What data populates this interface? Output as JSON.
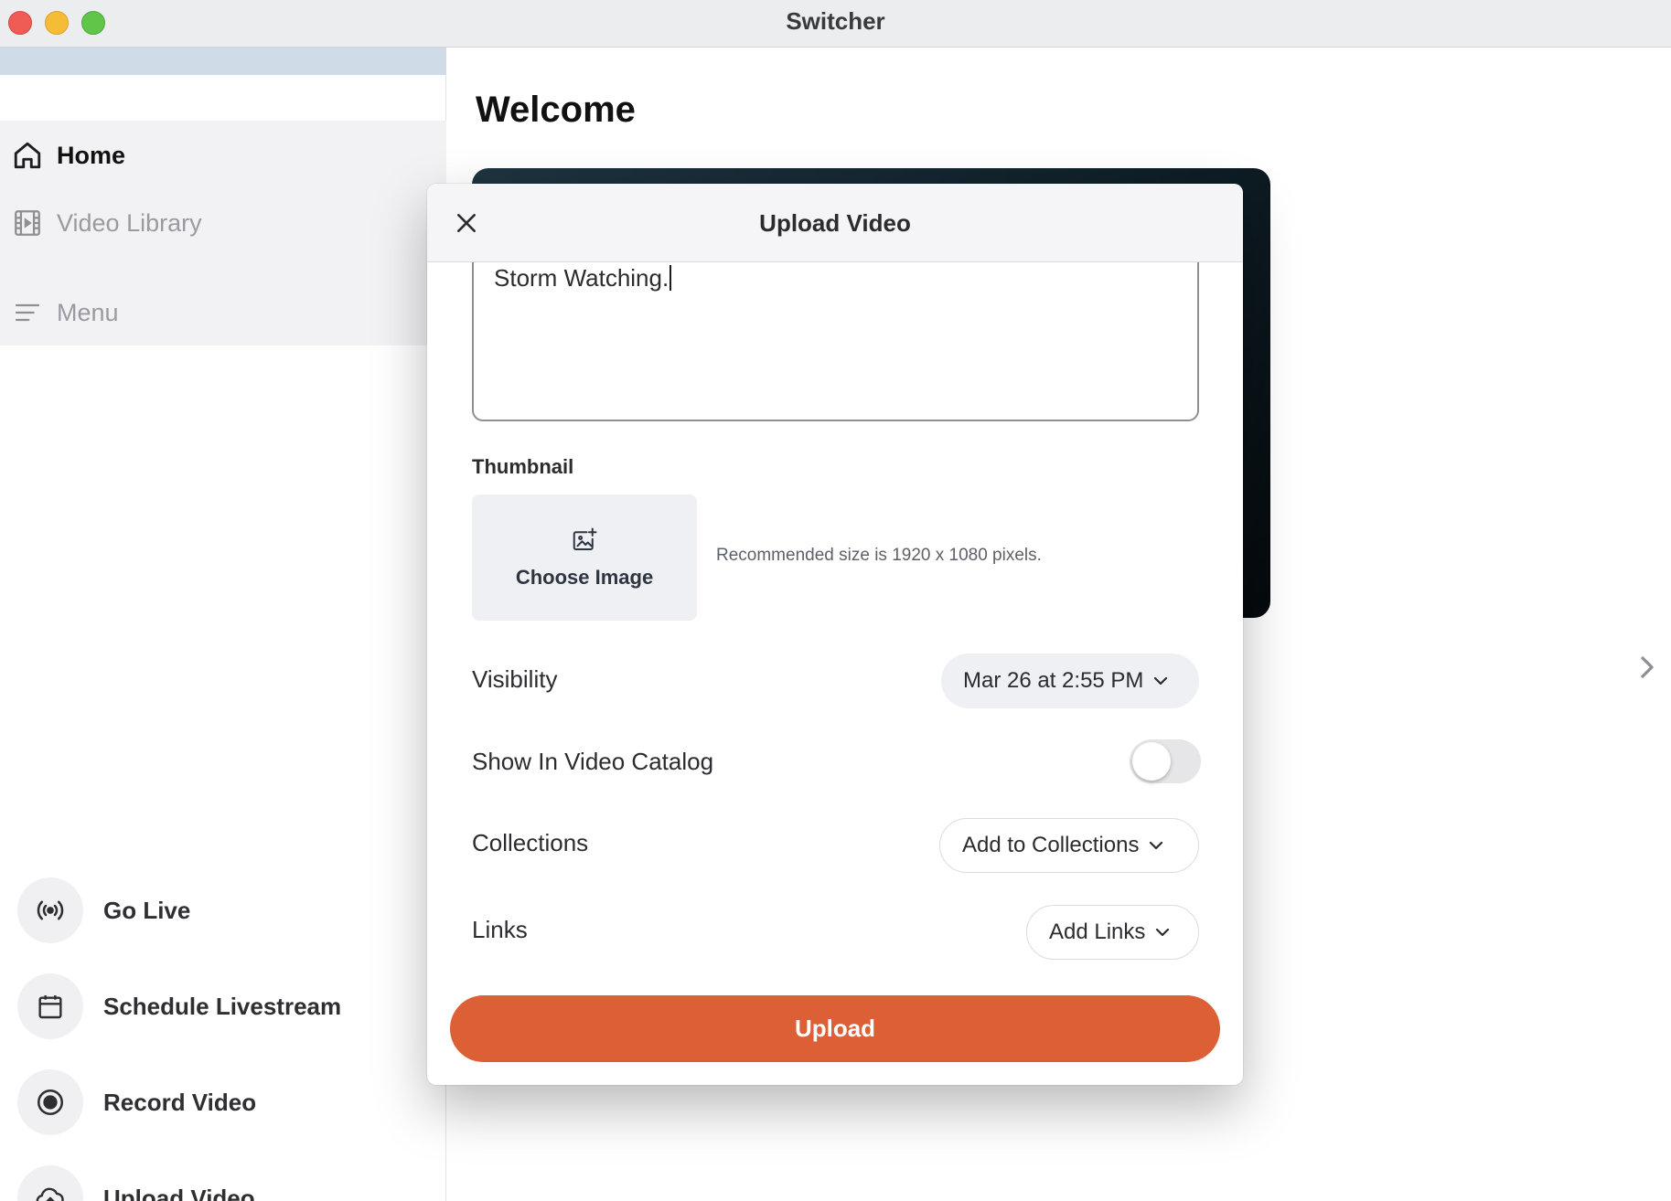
{
  "window": {
    "title": "Switcher"
  },
  "sidebar": {
    "nav": [
      {
        "label": "Home",
        "icon": "home-icon"
      },
      {
        "label": "Video Library",
        "icon": "film-icon"
      },
      {
        "label": "Menu",
        "icon": "menu-icon"
      }
    ],
    "actions": [
      {
        "label": "Go Live",
        "icon": "broadcast-icon"
      },
      {
        "label": "Schedule Livestream",
        "icon": "calendar-icon"
      },
      {
        "label": "Record Video",
        "icon": "record-icon"
      },
      {
        "label": "Upload Video",
        "icon": "cloud-upload-icon"
      }
    ]
  },
  "main": {
    "heading": "Welcome"
  },
  "modal": {
    "title": "Upload Video",
    "description_value": "Storm Watching.",
    "thumbnail": {
      "label": "Thumbnail",
      "button_label": "Choose Image",
      "hint": "Recommended size is 1920 x 1080 pixels."
    },
    "visibility": {
      "label": "Visibility",
      "value": "Mar 26 at 2:55 PM"
    },
    "catalog": {
      "label": "Show In Video Catalog",
      "enabled": false
    },
    "collections": {
      "label": "Collections",
      "button_label": "Add to Collections"
    },
    "links": {
      "label": "Links",
      "button_label": "Add Links"
    },
    "upload_label": "Upload"
  },
  "colors": {
    "accent": "#dc5f36",
    "close": "#ee5c55",
    "minimize": "#f5bd36",
    "maximize": "#5fc64a"
  }
}
